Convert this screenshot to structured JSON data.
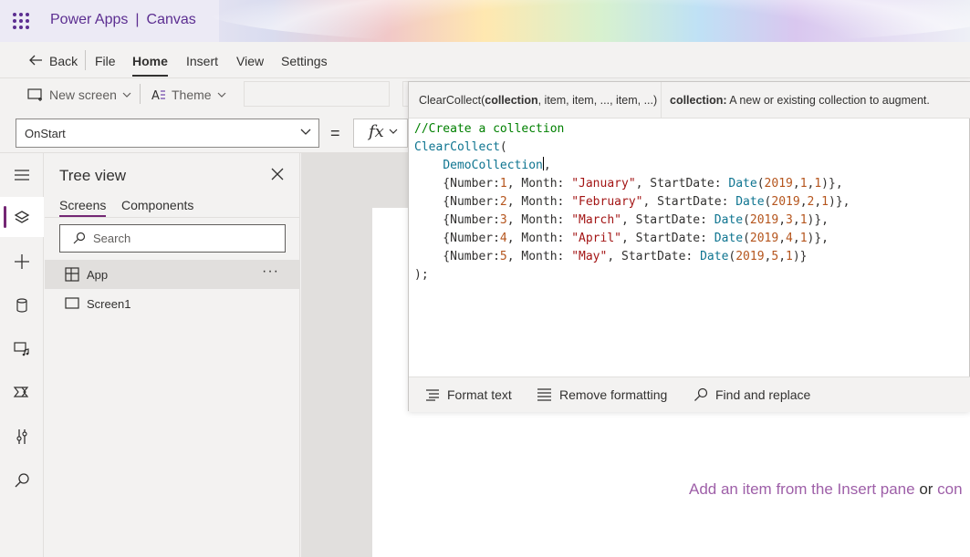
{
  "header": {
    "app_name": "Power Apps",
    "separator": "|",
    "app_type": "Canvas"
  },
  "menu": {
    "back": "Back",
    "file": "File",
    "home": "Home",
    "insert": "Insert",
    "view": "View",
    "settings": "Settings"
  },
  "toolbar": {
    "new_screen": "New screen",
    "theme": "Theme"
  },
  "formula_bar": {
    "property": "OnStart",
    "equals": "=",
    "fx": "fx"
  },
  "signature": {
    "function": "ClearCollect(",
    "param_bold": "collection",
    "params_rest": ", item, item, ..., item, ...)",
    "desc_label": "collection:",
    "desc_text": " A new or existing collection to augment."
  },
  "code": {
    "comment": "//Create a collection",
    "fn": "ClearCollect",
    "collection": "DemoCollection",
    "close": ");",
    "rows": [
      {
        "number": "1",
        "month": "\"January\"",
        "y": "2019",
        "m": "1",
        "d": "1",
        "end": ")},"
      },
      {
        "number": "2",
        "month": "\"February\"",
        "y": "2019",
        "m": "2",
        "d": "1",
        "end": ")},"
      },
      {
        "number": "3",
        "month": "\"March\"",
        "y": "2019",
        "m": "3",
        "d": "1",
        "end": ")},"
      },
      {
        "number": "4",
        "month": "\"April\"",
        "y": "2019",
        "m": "4",
        "d": "1",
        "end": ")},"
      },
      {
        "number": "5",
        "month": "\"May\"",
        "y": "2019",
        "m": "5",
        "d": "1",
        "end": ")}"
      }
    ]
  },
  "editor_footer": {
    "format": "Format text",
    "remove": "Remove formatting",
    "find": "Find and replace"
  },
  "tree": {
    "title": "Tree view",
    "tabs": [
      "Screens",
      "Components"
    ],
    "search_placeholder": "Search",
    "items": [
      {
        "label": "App",
        "more": "···"
      },
      {
        "label": "Screen1"
      }
    ]
  },
  "canvas": {
    "hint_link": "Add an item from the Insert pane",
    "hint_or": " or ",
    "hint_tail": "con"
  },
  "colors": {
    "accent": "#742774",
    "brand": "#5c2e91",
    "hint": "#9e5fa8"
  }
}
